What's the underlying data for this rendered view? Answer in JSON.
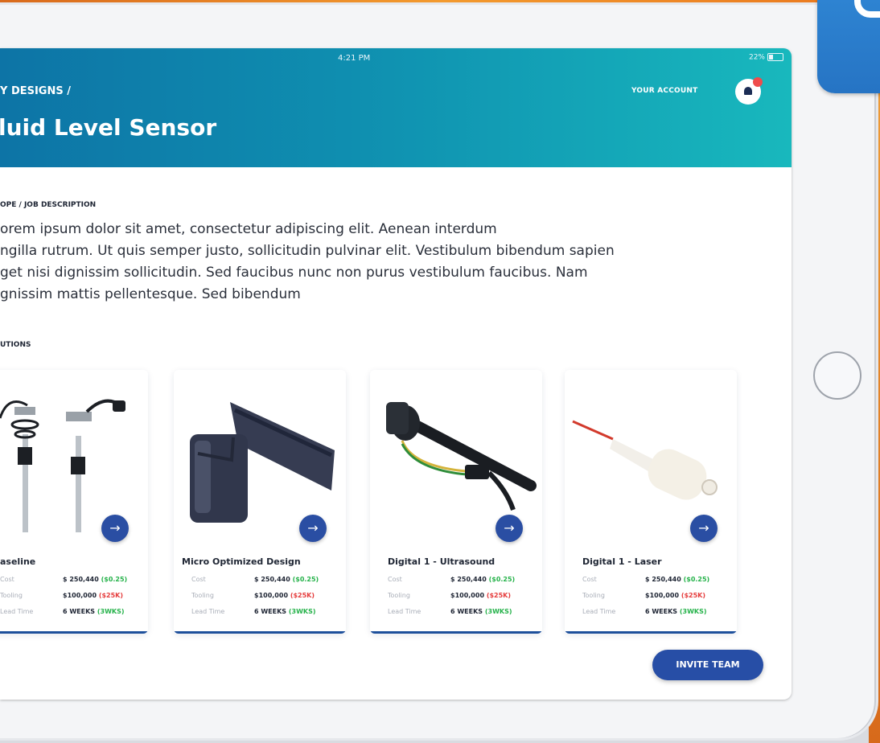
{
  "status": {
    "time": "4:21 PM",
    "battery": "22%"
  },
  "header": {
    "breadcrumb": "Y DESIGNS /",
    "title": "luid Level Sensor",
    "account": "YOUR ACCOUNT",
    "notifications_badge": ""
  },
  "scope": {
    "label": "OPE / JOB DESCRIPTION",
    "lines": [
      "orem ipsum dolor sit amet, consectetur adipiscing elit. Aenean interdum",
      "ngilla rutrum. Ut quis semper justo, sollicitudin pulvinar elit. Vestibulum bibendum sapien",
      "get nisi dignissim sollicitudin. Sed faucibus nunc non purus vestibulum faucibus. Nam",
      "gnissim mattis pellentesque. Sed bibendum"
    ]
  },
  "solutions": {
    "label": "UTIONS",
    "arrow_glyph": "→",
    "cards": [
      {
        "title": "aseline",
        "cost": "$ 250,440",
        "cost_delta": "($0.25)",
        "tooling": "$100,000",
        "tooling_delta": "($25K)",
        "lead": "6 WEEKS",
        "lead_delta": "(3WKS)",
        "labels": {
          "cost": "Cost",
          "tooling": "Tooling",
          "lead": "Lead Time"
        }
      },
      {
        "title": "Micro Optimized Design",
        "cost": "$ 250,440",
        "cost_delta": "($0.25)",
        "tooling": "$100,000",
        "tooling_delta": "($25K)",
        "lead": "6 WEEKS",
        "lead_delta": "(3WKS)",
        "labels": {
          "cost": "Cost",
          "tooling": "Tooling",
          "lead": "Lead Time"
        }
      },
      {
        "title": "Digital 1 - Ultrasound",
        "cost": "$ 250,440",
        "cost_delta": "($0.25)",
        "tooling": "$100,000",
        "tooling_delta": "($25K)",
        "lead": "6 WEEKS",
        "lead_delta": "(3WKS)",
        "labels": {
          "cost": "Cost",
          "tooling": "Tooling",
          "lead": "Lead Time"
        }
      },
      {
        "title": "Digital 1 - Laser",
        "cost": "$ 250,440",
        "cost_delta": "($0.25)",
        "tooling": "$100,000",
        "tooling_delta": "($25K)",
        "lead": "6 WEEKS",
        "lead_delta": "(3WKS)",
        "labels": {
          "cost": "Cost",
          "tooling": "Tooling",
          "lead": "Lead Time"
        }
      }
    ]
  },
  "actions": {
    "invite": "INVITE TEAM"
  },
  "colors": {
    "header_start": "#0d74a6",
    "header_end": "#18b8bd",
    "accent": "#274ea6",
    "positive": "#25b24a",
    "negative": "#e53c3c"
  }
}
